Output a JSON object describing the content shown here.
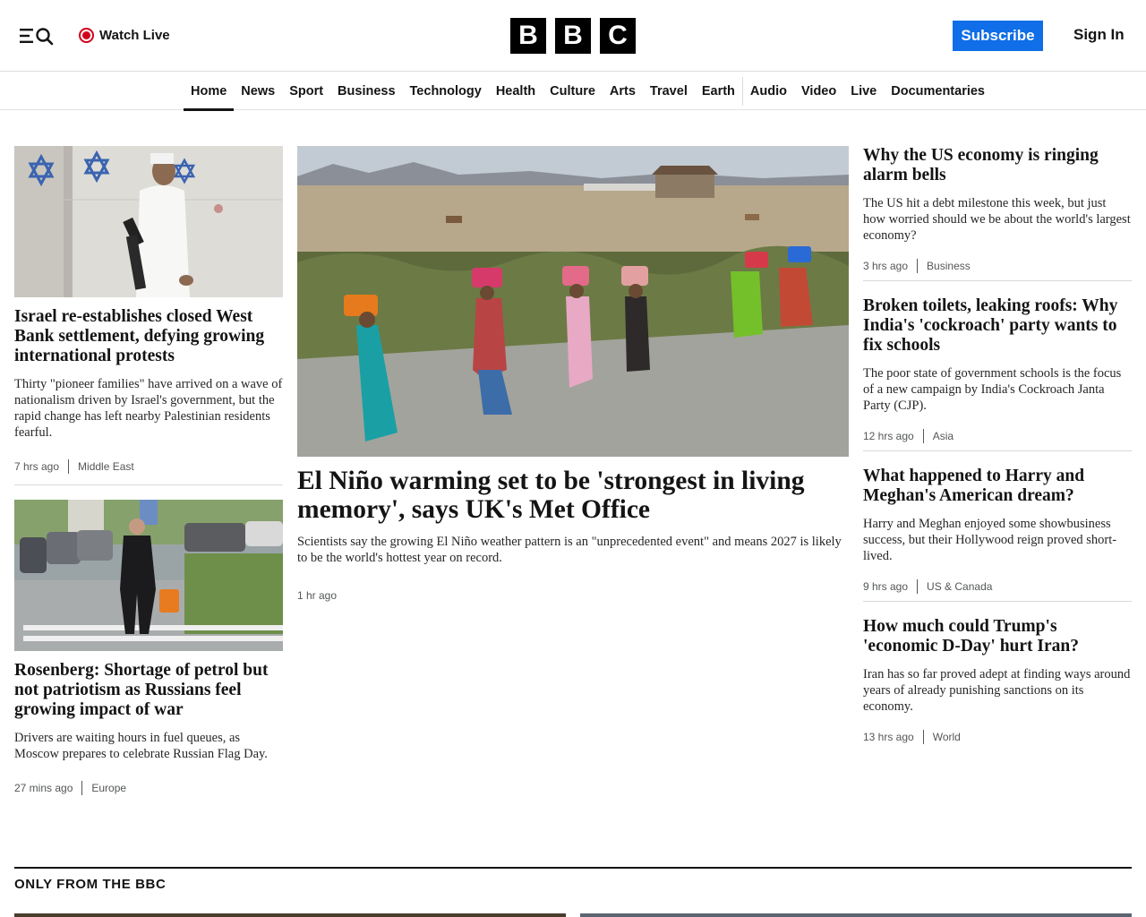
{
  "header": {
    "watch_live": "Watch Live",
    "logo_letters": [
      "B",
      "B",
      "C"
    ],
    "subscribe": "Subscribe",
    "sign_in": "Sign In",
    "brand_colors": {
      "subscribe_bg": "#0f6ee8",
      "live_red": "#d2021a"
    }
  },
  "nav": {
    "items": [
      "Home",
      "News",
      "Sport",
      "Business",
      "Technology",
      "Health",
      "Culture",
      "Arts",
      "Travel",
      "Earth",
      "Audio",
      "Video",
      "Live",
      "Documentaries"
    ],
    "active": "Home"
  },
  "left": {
    "stories": [
      {
        "headline": "Israel re-establishes closed West Bank settlement, defying growing international protests",
        "summary": "Thirty \"pioneer families\" have arrived on a wave of nationalism driven by Israel's government, but the rapid change has left nearby Palestinian residents fearful.",
        "time": "7 hrs ago",
        "section": "Middle East"
      },
      {
        "headline": "Rosenberg: Shortage of petrol but not patriotism as Russians feel growing impact of war",
        "summary": "Drivers are waiting hours in fuel queues, as Moscow prepares to celebrate Russian Flag Day.",
        "time": "27 mins ago",
        "section": "Europe"
      }
    ]
  },
  "main": {
    "headline": "El Niño warming set to be 'strongest in living memory', says UK's Met Office",
    "summary": "Scientists say the growing El Niño weather pattern is an \"unprecedented event\" and means 2027 is likely to be the world's hottest year on record.",
    "time": "1 hr ago"
  },
  "right": {
    "stories": [
      {
        "headline": "Why the US economy is ringing alarm bells",
        "summary": "The US hit a debt milestone this week, but just how worried should we be about the world's largest economy?",
        "time": "3 hrs ago",
        "section": "Business"
      },
      {
        "headline": "Broken toilets, leaking roofs: Why India's 'cockroach' party wants to fix schools",
        "summary": "The poor state of government schools is the focus of a new campaign by India's Cockroach Janta Party (CJP).",
        "time": "12 hrs ago",
        "section": "Asia"
      },
      {
        "headline": "What happened to Harry and Meghan's American dream?",
        "summary": "Harry and Meghan enjoyed some showbusiness success, but their Hollywood reign proved short-lived.",
        "time": "9 hrs ago",
        "section": "US & Canada"
      },
      {
        "headline": "How much could Trump's 'economic D-Day' hurt Iran?",
        "summary": "Iran has so far proved adept at finding ways around years of already punishing sanctions on its economy.",
        "time": "13 hrs ago",
        "section": "World"
      }
    ]
  },
  "section": {
    "title": "ONLY FROM THE BBC"
  }
}
